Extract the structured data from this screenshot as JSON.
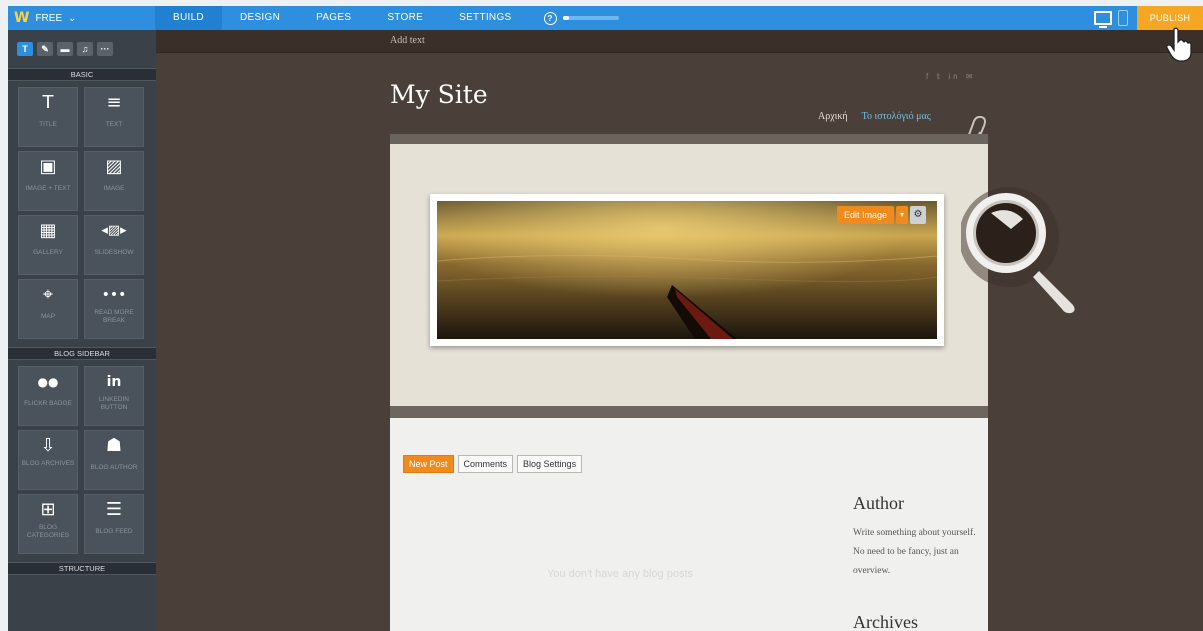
{
  "topbar": {
    "plan": "FREE",
    "plan_caret": "⌄",
    "tabs": [
      "BUILD",
      "DESIGN",
      "PAGES",
      "STORE",
      "SETTINGS"
    ],
    "active_tab": "BUILD",
    "help_glyph": "?",
    "progress_fraction": 0.12,
    "publish": "PUBLISH"
  },
  "sidebar": {
    "tools": [
      "T",
      "✎",
      "▬",
      "♫",
      "···"
    ],
    "sections": {
      "basic": "BASIC",
      "blog_sidebar": "BLOG SIDEBAR",
      "structure": "STRUCTURE"
    },
    "basic_items": [
      {
        "icon": "T",
        "label": "TITLE"
      },
      {
        "icon": "≡",
        "label": "TEXT"
      },
      {
        "icon": "▣",
        "label": "IMAGE + TEXT"
      },
      {
        "icon": "▨",
        "label": "IMAGE"
      },
      {
        "icon": "▦",
        "label": "GALLERY"
      },
      {
        "icon": "◂▨▸",
        "label": "SLIDESHOW"
      },
      {
        "icon": "⌖",
        "label": "MAP"
      },
      {
        "icon": "•••",
        "label": "READ MORE BREAK"
      }
    ],
    "blog_items": [
      {
        "icon": "●●",
        "label": "FLICKR BADGE"
      },
      {
        "icon": "in",
        "label": "LINKEDIN BUTTON"
      },
      {
        "icon": "⇩",
        "label": "BLOG ARCHIVES"
      },
      {
        "icon": "☗",
        "label": "BLOG AUTHOR"
      },
      {
        "icon": "⊞",
        "label": "BLOG CATEGORIES"
      },
      {
        "icon": "☰",
        "label": "BLOG FEED"
      }
    ]
  },
  "canvas": {
    "add_text": "Add text",
    "social": "f  𝕥  in  ✉",
    "site_title": "My Site",
    "menu": {
      "home": "Αρχική",
      "blog": "Το ιστολόγιό μας"
    },
    "edit_image": "Edit Image",
    "edit_caret": "▾",
    "edit_gear": "⚙",
    "buttons": {
      "new_post": "New Post",
      "comments": "Comments",
      "blog_settings": "Blog Settings"
    },
    "no_posts": "You don't have any blog posts",
    "author_heading": "Author",
    "author_text": "Write something about yourself. No need to be fancy, just an overview.",
    "archives_heading": "Archives"
  },
  "colors": {
    "topbar": "#2d8fdd",
    "publish": "#f5a623",
    "sidebar": "#3b4148",
    "canvas_bg": "#4b4039",
    "accent_orange": "#f08a1d"
  }
}
